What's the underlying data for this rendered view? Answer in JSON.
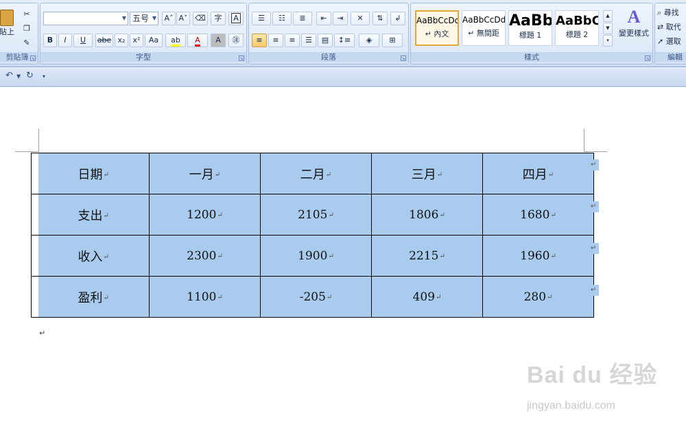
{
  "ribbon": {
    "clipboard": {
      "label": "剪貼簿",
      "paste_label": "貼上"
    },
    "font": {
      "label": "字型",
      "font_name_value": "",
      "font_size_value": "五号",
      "bold": "B",
      "italic": "I",
      "underline": "U",
      "strike": "abe",
      "subscript": "x₂",
      "superscript": "x²",
      "change_case": "Aa",
      "grow": "A˄",
      "shrink": "A˅",
      "font_color": "A"
    },
    "paragraph": {
      "label": "段落"
    },
    "styles": {
      "label": "樣式",
      "tiles": [
        {
          "sample": "AaBbCcDd",
          "name": "↵ 內文"
        },
        {
          "sample": "AaBbCcDd",
          "name": "↵ 無間距"
        },
        {
          "sample": "AaBb",
          "name": "標題 1"
        },
        {
          "sample": "AaBbC",
          "name": "標題 2"
        }
      ],
      "change_styles": "變更樣式"
    },
    "editing": {
      "label": "編輯",
      "find": "尋找",
      "replace": "取代",
      "select": "選取"
    }
  },
  "table": {
    "header": [
      "日期",
      "一月",
      "二月",
      "三月",
      "四月"
    ],
    "rows": [
      [
        "支出",
        "1200",
        "2105",
        "1806",
        "1680"
      ],
      [
        "收入",
        "2300",
        "1900",
        "2215",
        "1960"
      ],
      [
        "盈利",
        "1100",
        "-205",
        "409",
        "280"
      ]
    ]
  },
  "marks": {
    "cell_end": "↵",
    "para_end": "↵"
  },
  "watermark": {
    "logo": "Bai du 经验",
    "url": "jingyan.baidu.com"
  },
  "colors": {
    "cell_fill": "#a8cbee",
    "ribbon_bg": "#dbe7f7"
  }
}
